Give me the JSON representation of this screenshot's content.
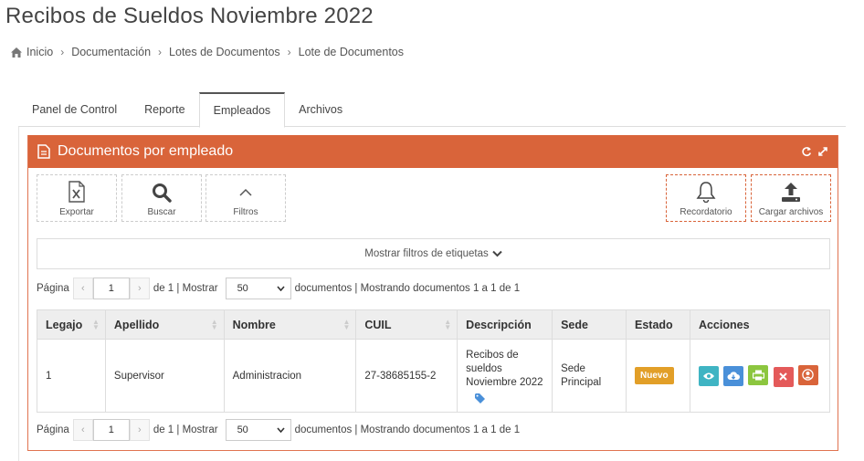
{
  "page": {
    "title": "Recibos de Sueldos Noviembre 2022"
  },
  "breadcrumb": {
    "home_icon": "home-icon",
    "items": [
      "Inicio",
      "Documentación",
      "Lotes de Documentos",
      "Lote de Documentos"
    ],
    "separator": "›"
  },
  "tabs": [
    {
      "label": "Panel de Control",
      "active": false
    },
    {
      "label": "Reporte",
      "active": false
    },
    {
      "label": "Empleados",
      "active": true
    },
    {
      "label": "Archivos",
      "active": false
    }
  ],
  "portlet": {
    "title": "Documentos por empleado",
    "header_color": "#d9643a",
    "tools": [
      "refresh-icon",
      "expand-icon"
    ]
  },
  "toolbar": {
    "export_label": "Exportar",
    "search_label": "Buscar",
    "filters_label": "Filtros",
    "reminder_label": "Recordatorio",
    "upload_label": "Cargar archivos"
  },
  "filter_bar": {
    "label": "Mostrar filtros de etiquetas"
  },
  "pager_top": {
    "label_page": "Página",
    "page_value": "1",
    "of_text": "de 1 | Mostrar",
    "per_page": "50",
    "summary": "documentos | Mostrando documentos 1 a 1 de 1"
  },
  "pager_bottom": {
    "label_page": "Página",
    "page_value": "1",
    "of_text": "de 1 | Mostrar",
    "per_page": "50",
    "summary": "documentos | Mostrando documentos 1 a 1 de 1"
  },
  "table": {
    "columns": [
      "Legajo",
      "Apellido",
      "Nombre",
      "CUIL",
      "Descripción",
      "Sede",
      "Estado",
      "Acciones"
    ],
    "rows": [
      {
        "legajo": "1",
        "apellido": "Supervisor",
        "nombre": "Administracion",
        "cuil": "27-38685155-2",
        "descripcion": "Recibos de sueldos Noviembre 2022",
        "sede": "Sede Principal",
        "estado": "Nuevo"
      }
    ],
    "actions": [
      {
        "icon": "view-icon",
        "color": "#3fb4c3"
      },
      {
        "icon": "cloud-download-icon",
        "color": "#4a90d9"
      },
      {
        "icon": "print-icon",
        "color": "#8cc63f"
      },
      {
        "icon": "delete-icon",
        "color": "#e45a5a"
      },
      {
        "icon": "user-icon",
        "color": "#d9643a"
      }
    ],
    "status_color": "#e29f28"
  }
}
